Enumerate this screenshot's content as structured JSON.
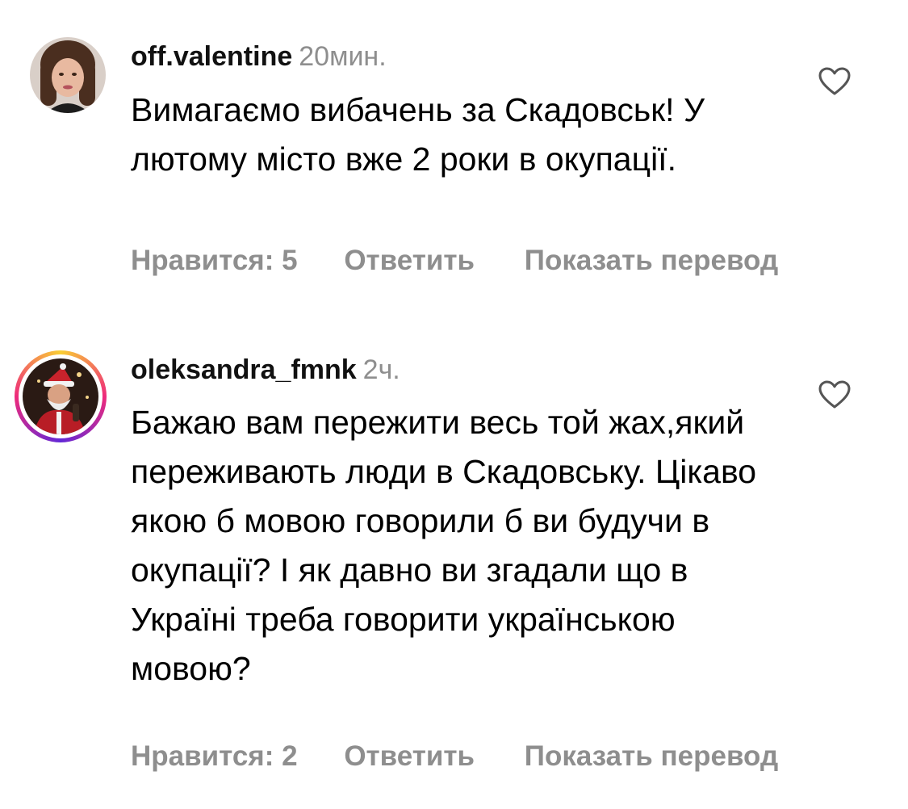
{
  "comments": [
    {
      "username": "off.valentine",
      "time": "20мин.",
      "text": "Вимагаємо вибачень за Скадовськ! У лютому місто вже 2 роки в окупації.",
      "likes": "Нравится: 5",
      "reply": "Ответить",
      "translate": "Показать перевод",
      "has_story": false
    },
    {
      "username": "oleksandra_fmnk",
      "time": "2ч.",
      "text": "Бажаю вам пережити весь той жах,який переживають люди в Скадовську. Цікаво якою б мовою говорили б ви будучи в окупації? І як давно ви згадали що в Україні треба говорити українською мовою?",
      "likes": "Нравится: 2",
      "reply": "Ответить",
      "translate": "Показать перевод",
      "has_story": true
    }
  ],
  "icons": {
    "like": "heart-outline-icon"
  },
  "colors": {
    "secondary_text": "#8e8e8e",
    "primary_text": "#000000",
    "story_ring": [
      "#f9ce34",
      "#ee2a7b",
      "#6228d7"
    ]
  }
}
